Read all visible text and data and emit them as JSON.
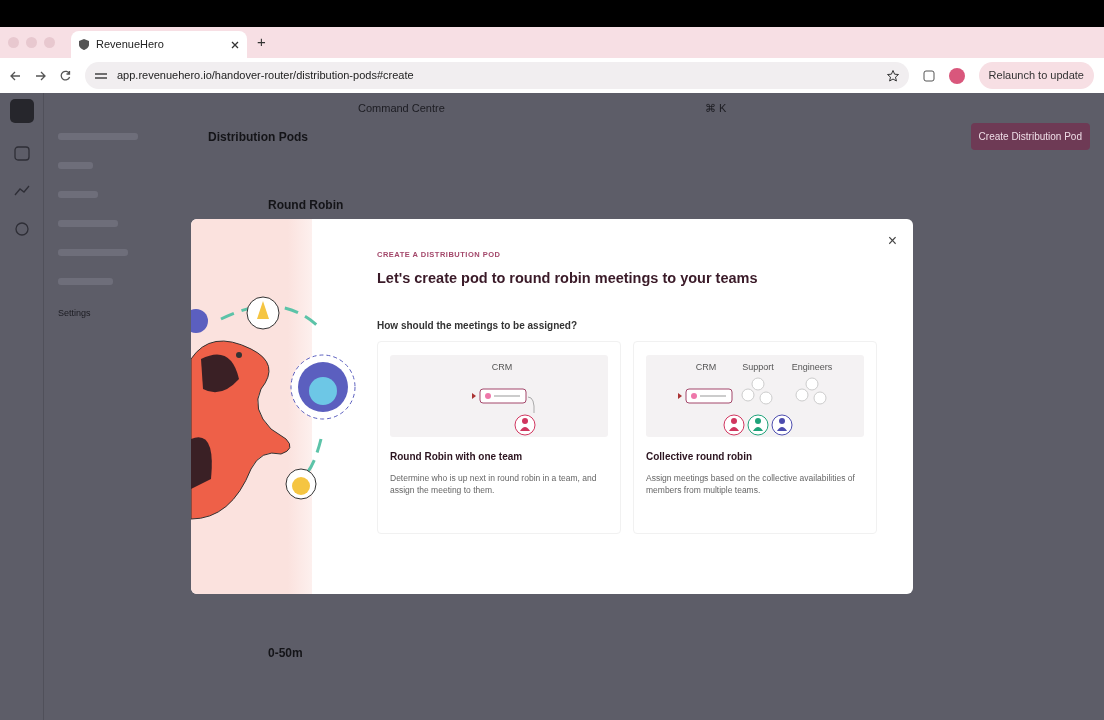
{
  "browser": {
    "tab_title": "RevenueHero",
    "new_tab": "+",
    "url": "app.revenuehero.io/handover-router/distribution-pods#create",
    "relaunch_button": "Relaunch to update"
  },
  "app": {
    "search": "Command Centre",
    "shortcut": "⌘ K",
    "page_title": "Distribution Pods",
    "create_button": "Create Distribution Pod",
    "subnav": [
      "Settings"
    ],
    "pods": [
      {
        "title": "Round Robin"
      },
      {
        "title": "0-50m"
      }
    ]
  },
  "modal": {
    "eyebrow": "CREATE A DISTRIBUTION POD",
    "title": "Let's create pod to round robin meetings to your teams",
    "question": "How should the meetings to be assigned?",
    "close": "×",
    "options": [
      {
        "kind": "single",
        "title": "Round Robin with one team",
        "description": "Determine who is up next in round robin in a team, and assign the meeting to them.",
        "labels": [
          "CRM"
        ]
      },
      {
        "kind": "collective",
        "title": "Collective round robin",
        "description": "Assign meetings based on the collective availabilities of members from multiple teams.",
        "labels": [
          "CRM",
          "Support",
          "Engineers"
        ]
      }
    ]
  }
}
